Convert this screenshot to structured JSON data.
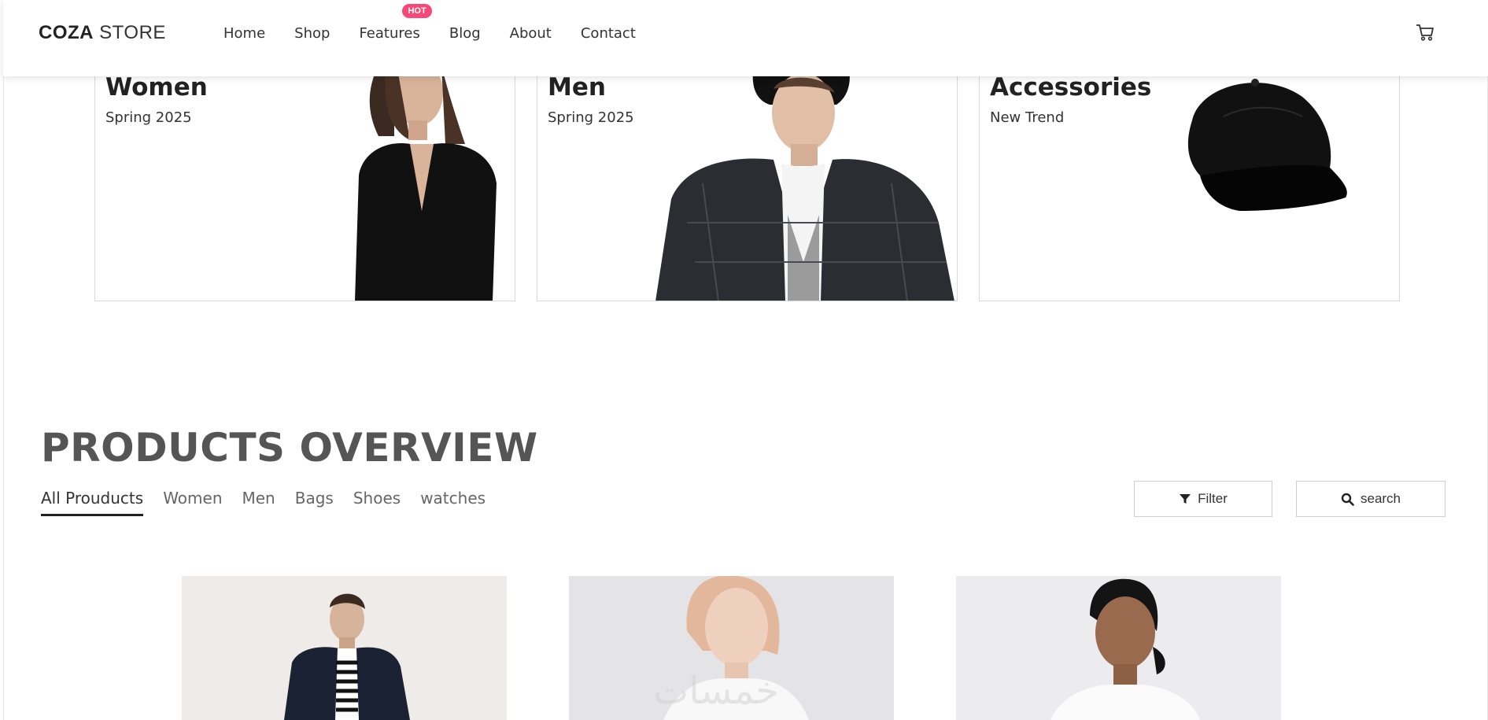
{
  "header": {
    "logo_bold": "COZA",
    "logo_light": " STORE",
    "nav": [
      "Home",
      "Shop",
      "Features",
      "Blog",
      "About",
      "Contact"
    ],
    "hot_badge": "HOT"
  },
  "banners": [
    {
      "title": "Women",
      "subtitle": "Spring 2025"
    },
    {
      "title": "Men",
      "subtitle": "Spring 2025"
    },
    {
      "title": "Accessories",
      "subtitle": "New Trend"
    }
  ],
  "products_overview": {
    "title": "PRODUCTS OVERVIEW",
    "tabs": [
      "All Prouducts",
      "Women",
      "Men",
      "Bags",
      "Shoes",
      "watches"
    ],
    "filter_label": "Filter",
    "search_label": "search"
  },
  "watermark": "خمسات",
  "colors": {
    "hot_badge": "#f74877",
    "title_gray": "#555555",
    "border": "#d9d9d9"
  }
}
